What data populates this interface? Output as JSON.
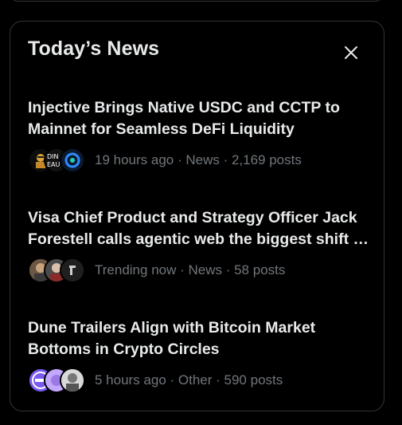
{
  "panel": {
    "title": "Today’s News",
    "close_icon": "close-icon"
  },
  "news": [
    {
      "headline": "Injective Brings Native USDC and CCTP to Mainnet for Seamless DeFi Liquidity",
      "meta": "19 hours ago · News · 2,169 posts",
      "avatars": [
        "avatar-injective-1",
        "avatar-injective-2",
        "avatar-injective-3"
      ]
    },
    {
      "headline": "Visa Chief Product and Strategy Officer Jack Forestell calls agentic web the biggest shift in commerce",
      "meta": "Trending now · News · 58 posts",
      "avatars": [
        "avatar-visa-1",
        "avatar-visa-2",
        "avatar-visa-3"
      ]
    },
    {
      "headline": "Dune Trailers Align with Bitcoin Market Bottoms in Crypto Circles",
      "meta": "5 hours ago · Other · 590 posts",
      "avatars": [
        "avatar-dune-1",
        "avatar-dune-2",
        "avatar-dune-3"
      ]
    }
  ],
  "colors": {
    "background": "#000000",
    "border": "#2f3336",
    "text_primary": "#e7e9ea",
    "text_secondary": "#71767b"
  }
}
